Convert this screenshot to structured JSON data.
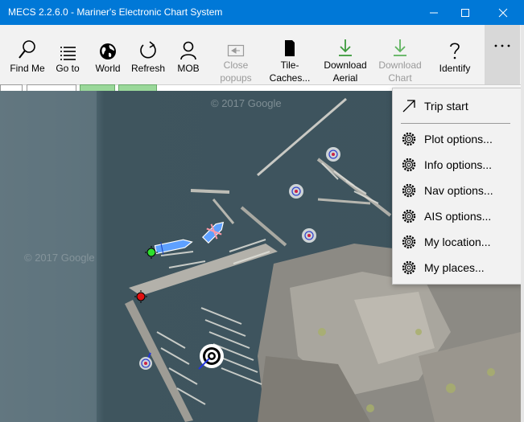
{
  "window": {
    "title": "MECS 2.2.6.0 - Mariner's Electronic Chart System"
  },
  "toolbar": {
    "items": [
      {
        "label": "Find Me",
        "icon": "search-icon",
        "enabled": true
      },
      {
        "label": "Go to",
        "icon": "list-icon",
        "enabled": true
      },
      {
        "label": "World",
        "icon": "globe-icon",
        "enabled": true
      },
      {
        "label": "Refresh",
        "icon": "refresh-icon",
        "enabled": true
      },
      {
        "label": "MOB",
        "icon": "person-icon",
        "enabled": true
      },
      {
        "label": "Close popups",
        "label_line1": "Close",
        "label_line2": "popups",
        "icon": "close-popups-icon",
        "enabled": false
      },
      {
        "label": "Tile-Caches...",
        "label_line1": "Tile-",
        "label_line2": "Caches...",
        "icon": "sd-card-icon",
        "enabled": true
      },
      {
        "label": "Download Aerial",
        "label_line1": "Download",
        "label_line2": "Aerial",
        "icon": "download-icon",
        "enabled": true
      },
      {
        "label": "Download Chart",
        "label_line1": "Download",
        "label_line2": "Chart",
        "icon": "download-icon",
        "enabled": false
      },
      {
        "label": "Identify",
        "icon": "question-icon",
        "enabled": true
      }
    ],
    "more_label": "···"
  },
  "map": {
    "watermarks": [
      "© 2017 Google",
      "© 2017 Google"
    ]
  },
  "menu": {
    "items": [
      {
        "label": "Trip start",
        "icon": "arrow-up-right-icon"
      },
      {
        "label": "Plot options...",
        "icon": "gear-icon"
      },
      {
        "label": "Info options...",
        "icon": "gear-icon"
      },
      {
        "label": "Nav options...",
        "icon": "gear-icon"
      },
      {
        "label": "AIS options...",
        "icon": "gear-icon"
      },
      {
        "label": "My location...",
        "icon": "gear-icon"
      },
      {
        "label": "My places...",
        "icon": "gear-icon"
      }
    ]
  },
  "colors": {
    "titlebar": "#0078d7",
    "toolbar_bg": "#f2f2f2",
    "download_green": "#3c9a3c",
    "disabled_gray": "#9a9a9a"
  }
}
